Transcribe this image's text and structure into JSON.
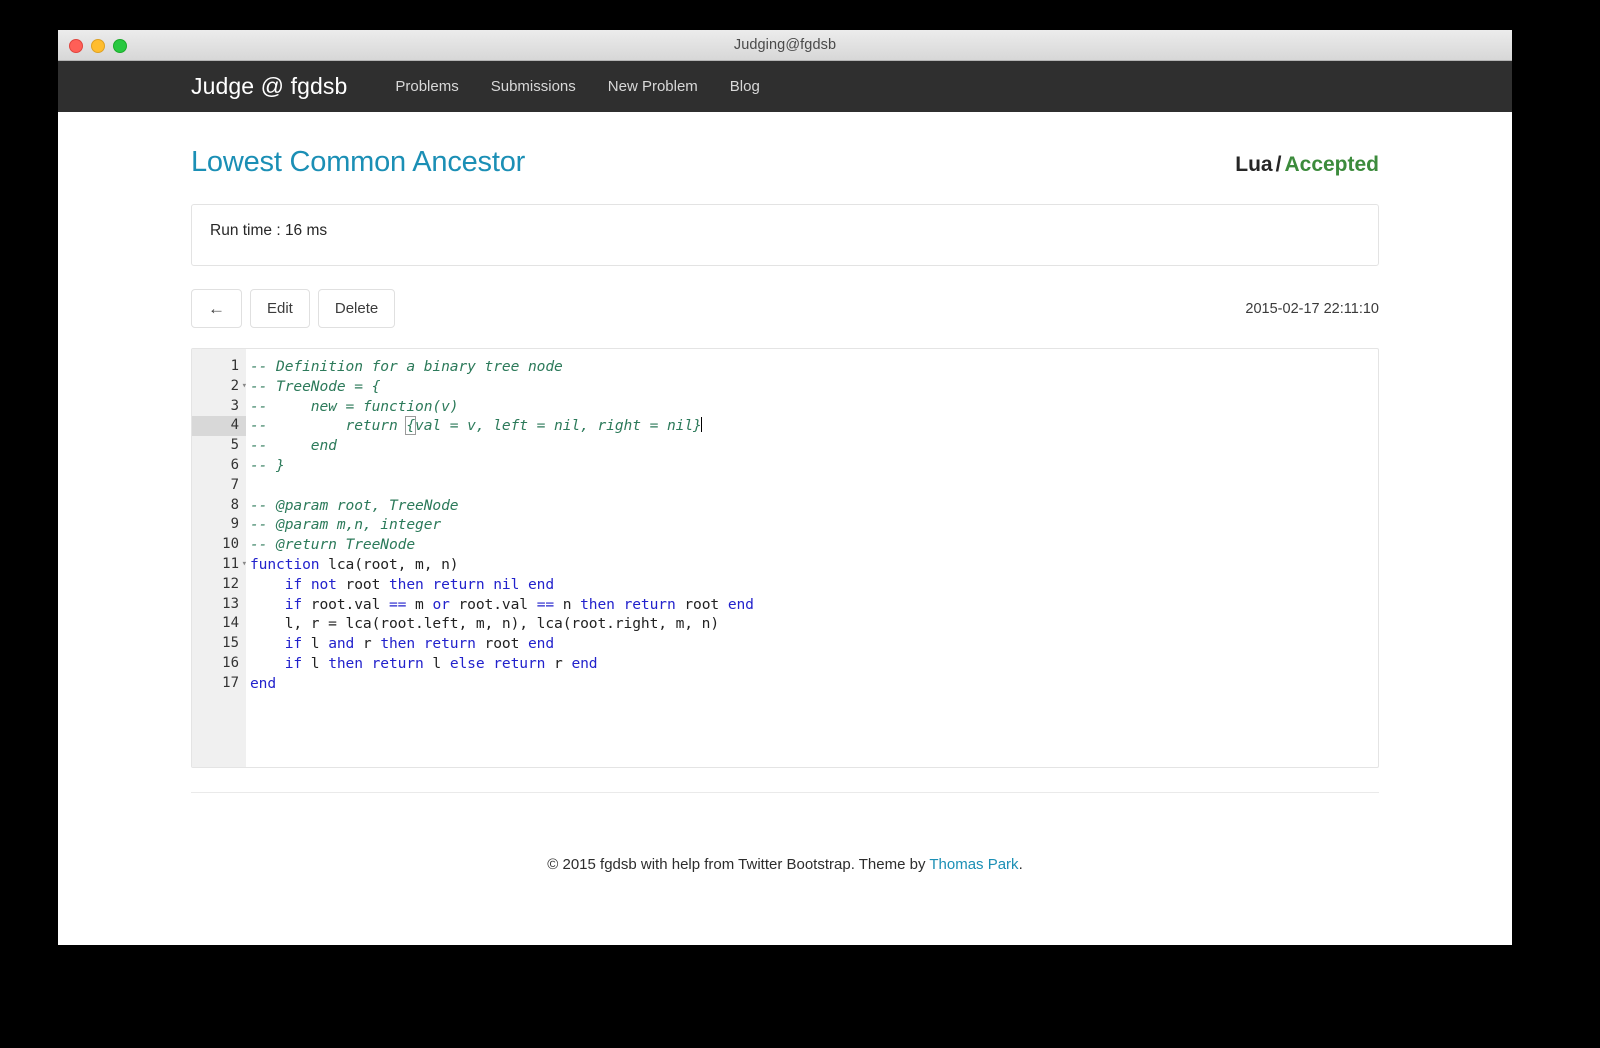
{
  "window": {
    "title": "Judging@fgdsb",
    "controls": [
      "close",
      "minimize",
      "maximize"
    ]
  },
  "navbar": {
    "brand": "Judge @ fgdsb",
    "links": [
      {
        "label": "Problems"
      },
      {
        "label": "Submissions"
      },
      {
        "label": "New Problem"
      },
      {
        "label": "Blog"
      }
    ]
  },
  "header": {
    "page_title": "Lowest Common Ancestor",
    "language": "Lua",
    "separator": "/",
    "verdict": "Accepted",
    "verdict_color": "#3c8b3c",
    "title_color": "#1b8fb5"
  },
  "runtime": {
    "text": "Run time : 16 ms"
  },
  "toolbar": {
    "back_label": "←",
    "edit_label": "Edit",
    "delete_label": "Delete",
    "timestamp": "2015-02-17 22:11:10"
  },
  "editor": {
    "active_line": 4,
    "fold_lines": [
      2,
      11
    ],
    "line_numbers": [
      "1",
      "2",
      "3",
      "4",
      "5",
      "6",
      "7",
      "8",
      "9",
      "10",
      "11",
      "12",
      "13",
      "14",
      "15",
      "16",
      "17"
    ],
    "lines": [
      {
        "n": 1,
        "tokens": [
          {
            "t": "-- Definition for a binary tree node",
            "c": "cm"
          }
        ]
      },
      {
        "n": 2,
        "tokens": [
          {
            "t": "-- TreeNode = {",
            "c": "cm"
          }
        ]
      },
      {
        "n": 3,
        "tokens": [
          {
            "t": "--     new = function(v)",
            "c": "cm"
          }
        ]
      },
      {
        "n": 4,
        "tokens": [
          {
            "t": "--         return ",
            "c": "cm"
          },
          {
            "t": "{",
            "c": "cm brk-match"
          },
          {
            "t": "val = v, left = nil, right = nil}",
            "c": "cm"
          }
        ]
      },
      {
        "n": 5,
        "tokens": [
          {
            "t": "--     end",
            "c": "cm"
          }
        ]
      },
      {
        "n": 6,
        "tokens": [
          {
            "t": "-- }",
            "c": "cm"
          }
        ]
      },
      {
        "n": 7,
        "tokens": [
          {
            "t": "",
            "c": "pl"
          }
        ]
      },
      {
        "n": 8,
        "tokens": [
          {
            "t": "-- @param root, TreeNode",
            "c": "cm"
          }
        ]
      },
      {
        "n": 9,
        "tokens": [
          {
            "t": "-- @param m,n, integer",
            "c": "cm"
          }
        ]
      },
      {
        "n": 10,
        "tokens": [
          {
            "t": "-- @return TreeNode",
            "c": "cm"
          }
        ]
      },
      {
        "n": 11,
        "tokens": [
          {
            "t": "function",
            "c": "kw"
          },
          {
            "t": " lca(root, m, n)",
            "c": "pl"
          }
        ]
      },
      {
        "n": 12,
        "tokens": [
          {
            "t": "    ",
            "c": "pl"
          },
          {
            "t": "if",
            "c": "kw"
          },
          {
            "t": " ",
            "c": "pl"
          },
          {
            "t": "not",
            "c": "kw"
          },
          {
            "t": " root ",
            "c": "pl"
          },
          {
            "t": "then",
            "c": "kw"
          },
          {
            "t": " ",
            "c": "pl"
          },
          {
            "t": "return",
            "c": "kw"
          },
          {
            "t": " ",
            "c": "pl"
          },
          {
            "t": "nil",
            "c": "kw"
          },
          {
            "t": " ",
            "c": "pl"
          },
          {
            "t": "end",
            "c": "kw"
          }
        ]
      },
      {
        "n": 13,
        "tokens": [
          {
            "t": "    ",
            "c": "pl"
          },
          {
            "t": "if",
            "c": "kw"
          },
          {
            "t": " root.val ",
            "c": "pl"
          },
          {
            "t": "==",
            "c": "kw"
          },
          {
            "t": " m ",
            "c": "pl"
          },
          {
            "t": "or",
            "c": "kw"
          },
          {
            "t": " root.val ",
            "c": "pl"
          },
          {
            "t": "==",
            "c": "kw"
          },
          {
            "t": " n ",
            "c": "pl"
          },
          {
            "t": "then",
            "c": "kw"
          },
          {
            "t": " ",
            "c": "pl"
          },
          {
            "t": "return",
            "c": "kw"
          },
          {
            "t": " root ",
            "c": "pl"
          },
          {
            "t": "end",
            "c": "kw"
          }
        ]
      },
      {
        "n": 14,
        "tokens": [
          {
            "t": "    l, r = lca(root.left, m, n), lca(root.right, m, n)",
            "c": "pl"
          }
        ]
      },
      {
        "n": 15,
        "tokens": [
          {
            "t": "    ",
            "c": "pl"
          },
          {
            "t": "if",
            "c": "kw"
          },
          {
            "t": " l ",
            "c": "pl"
          },
          {
            "t": "and",
            "c": "kw"
          },
          {
            "t": " r ",
            "c": "pl"
          },
          {
            "t": "then",
            "c": "kw"
          },
          {
            "t": " ",
            "c": "pl"
          },
          {
            "t": "return",
            "c": "kw"
          },
          {
            "t": " root ",
            "c": "pl"
          },
          {
            "t": "end",
            "c": "kw"
          }
        ]
      },
      {
        "n": 16,
        "tokens": [
          {
            "t": "    ",
            "c": "pl"
          },
          {
            "t": "if",
            "c": "kw"
          },
          {
            "t": " l ",
            "c": "pl"
          },
          {
            "t": "then",
            "c": "kw"
          },
          {
            "t": " ",
            "c": "pl"
          },
          {
            "t": "return",
            "c": "kw"
          },
          {
            "t": " l ",
            "c": "pl"
          },
          {
            "t": "else",
            "c": "kw"
          },
          {
            "t": " ",
            "c": "pl"
          },
          {
            "t": "return",
            "c": "kw"
          },
          {
            "t": " r ",
            "c": "pl"
          },
          {
            "t": "end",
            "c": "kw"
          }
        ]
      },
      {
        "n": 17,
        "tokens": [
          {
            "t": "end",
            "c": "kw"
          }
        ]
      }
    ]
  },
  "footer": {
    "text_before": "© 2015 fgdsb with help from Twitter Bootstrap. Theme by ",
    "link_label": "Thomas Park",
    "text_after": "."
  }
}
